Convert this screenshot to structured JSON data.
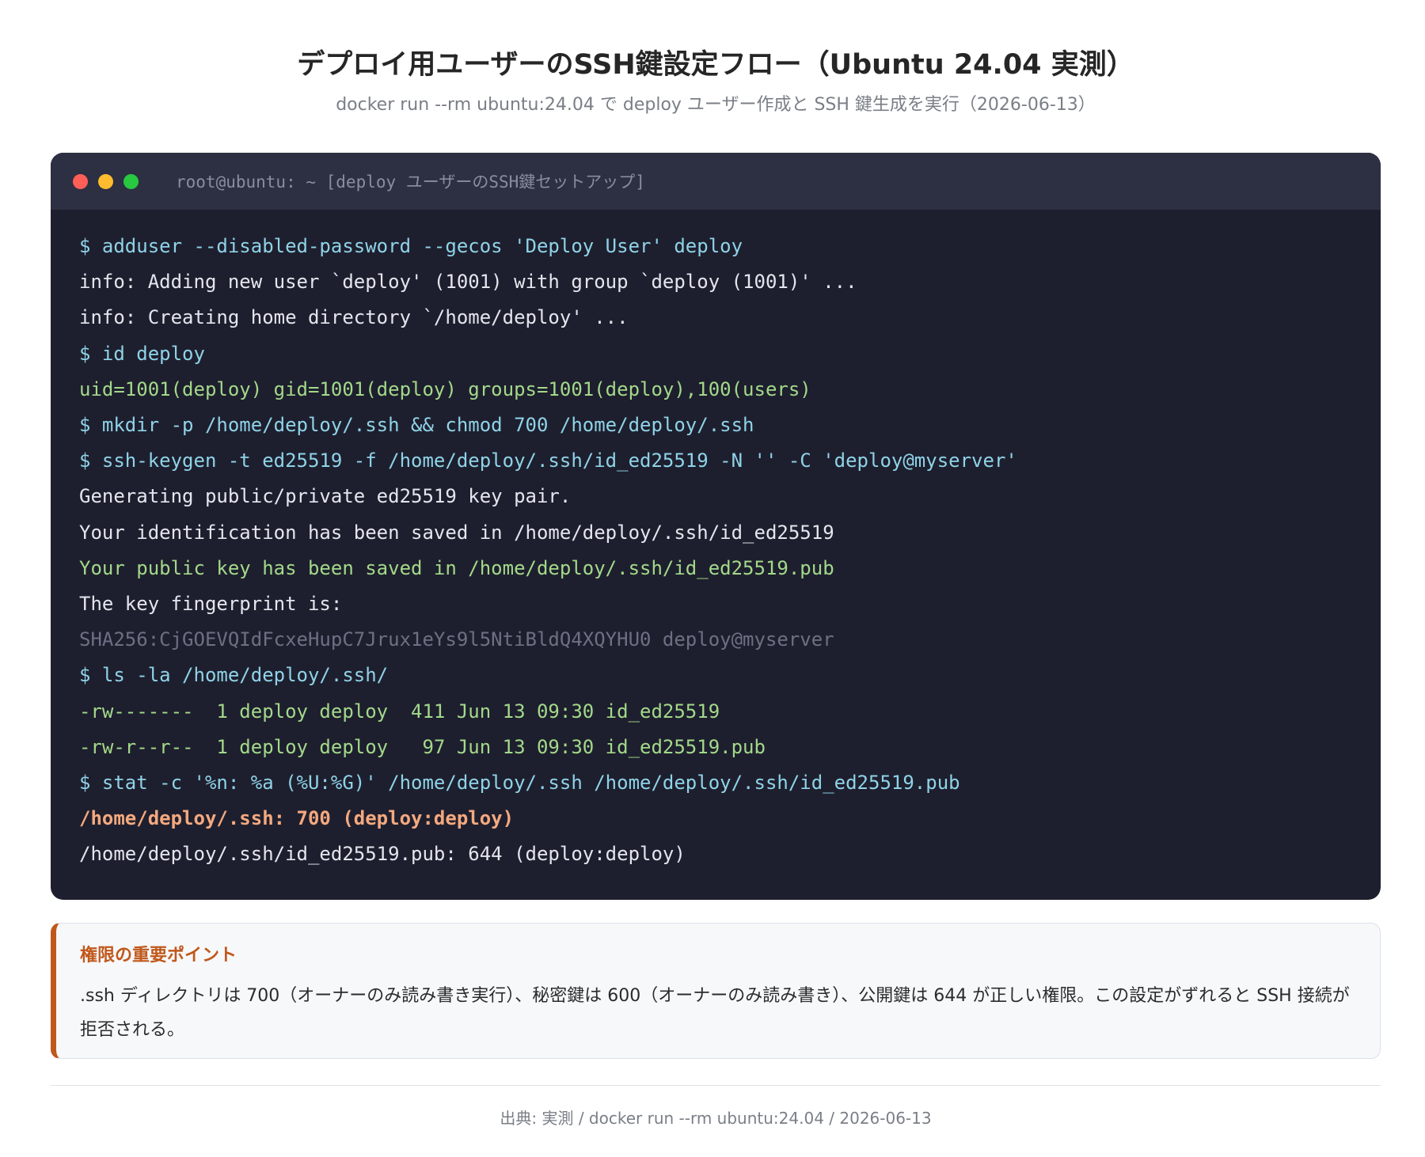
{
  "header": {
    "title": "デプロイ用ユーザーのSSH鍵設定フロー（Ubuntu 24.04 実測）",
    "subtitle": "docker run --rm ubuntu:24.04 で deploy ユーザー作成と SSH 鍵生成を実行（2026-06-13）"
  },
  "terminal": {
    "window_title": "root@ubuntu: ~ [deploy ユーザーのSSH鍵セットアップ]",
    "window_buttons": [
      {
        "name": "close",
        "color": "#ff5f57"
      },
      {
        "name": "minimize",
        "color": "#febc2e"
      },
      {
        "name": "maximize",
        "color": "#28c840"
      }
    ],
    "lines": [
      {
        "kind": "cmd",
        "text": "$ adduser --disabled-password --gecos 'Deploy User' deploy"
      },
      {
        "kind": "out",
        "text": "info: Adding new user `deploy' (1001) with group `deploy (1001)' ..."
      },
      {
        "kind": "out",
        "text": "info: Creating home directory `/home/deploy' ..."
      },
      {
        "kind": "cmd",
        "text": "$ id deploy"
      },
      {
        "kind": "ok",
        "text": "uid=1001(deploy) gid=1001(deploy) groups=1001(deploy),100(users)"
      },
      {
        "kind": "cmd",
        "text": "$ mkdir -p /home/deploy/.ssh && chmod 700 /home/deploy/.ssh"
      },
      {
        "kind": "cmd",
        "text": "$ ssh-keygen -t ed25519 -f /home/deploy/.ssh/id_ed25519 -N '' -C 'deploy@myserver'"
      },
      {
        "kind": "out",
        "text": "Generating public/private ed25519 key pair."
      },
      {
        "kind": "out",
        "text": "Your identification has been saved in /home/deploy/.ssh/id_ed25519"
      },
      {
        "kind": "ok",
        "text": "Your public key has been saved in /home/deploy/.ssh/id_ed25519.pub"
      },
      {
        "kind": "out",
        "text": "The key fingerprint is:"
      },
      {
        "kind": "dim",
        "text": "SHA256:CjGOEVQIdFcxeHupC7Jrux1eYs9l5NtiBldQ4XQYHU0 deploy@myserver"
      },
      {
        "kind": "cmd",
        "text": "$ ls -la /home/deploy/.ssh/"
      },
      {
        "kind": "ok",
        "text": "-rw-------  1 deploy deploy  411 Jun 13 09:30 id_ed25519"
      },
      {
        "kind": "ok",
        "text": "-rw-r--r--  1 deploy deploy   97 Jun 13 09:30 id_ed25519.pub"
      },
      {
        "kind": "cmd",
        "text": "$ stat -c '%n: %a (%U:%G)' /home/deploy/.ssh /home/deploy/.ssh/id_ed25519.pub"
      },
      {
        "kind": "warn",
        "text": "/home/deploy/.ssh: 700 (deploy:deploy)"
      },
      {
        "kind": "out",
        "text": "/home/deploy/.ssh/id_ed25519.pub: 644 (deploy:deploy)"
      }
    ]
  },
  "callout": {
    "heading": "権限の重要ポイント",
    "body": ".ssh ディレクトリは 700（オーナーのみ読み書き実行）、秘密鍵は 600（オーナーのみ読み書き）、公開鍵は 644 が正しい権限。この設定がずれると SSH 接続が拒否される。",
    "accent_color": "#c0581b"
  },
  "footer": {
    "source": "出典: 実測 / docker run --rm ubuntu:24.04 / 2026-06-13"
  }
}
